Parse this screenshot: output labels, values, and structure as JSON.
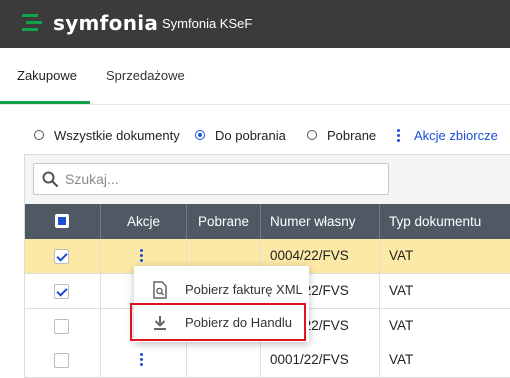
{
  "header": {
    "brand": "symfonia",
    "app_name": "Symfonia KSeF",
    "brand_color": "#12a24b",
    "background": "#3b3b3b"
  },
  "tabs": [
    {
      "label": "Zakupowe",
      "active": true
    },
    {
      "label": "Sprzedażowe",
      "active": false
    }
  ],
  "filter": {
    "options": [
      {
        "label": "Wszystkie dokumenty",
        "selected": false
      },
      {
        "label": "Do pobrania",
        "selected": true
      },
      {
        "label": "Pobrane",
        "selected": false
      }
    ],
    "bulk_actions_label": "Akcje zbiorcze"
  },
  "search": {
    "placeholder": "Szukaj...",
    "value": ""
  },
  "table": {
    "columns": [
      "Akcje",
      "Pobrane",
      "Numer własny",
      "Typ dokumentu"
    ],
    "rows": [
      {
        "checked": true,
        "selected": true,
        "numer": "0004/22/FVS",
        "typ": "VAT"
      },
      {
        "checked": true,
        "selected": false,
        "numer": "0003/22/FVS",
        "typ": "VAT"
      },
      {
        "checked": false,
        "selected": false,
        "numer": "0002/22/FVS",
        "typ": "VAT"
      },
      {
        "checked": false,
        "selected": false,
        "numer": "0001/22/FVS",
        "typ": "VAT"
      }
    ]
  },
  "context_menu": {
    "items": [
      {
        "label": "Pobierz fakturę XML",
        "icon": "xml-file-search-icon"
      },
      {
        "label": "Pobierz do Handlu",
        "icon": "download-icon"
      }
    ],
    "highlight_color": "#e0141e"
  }
}
